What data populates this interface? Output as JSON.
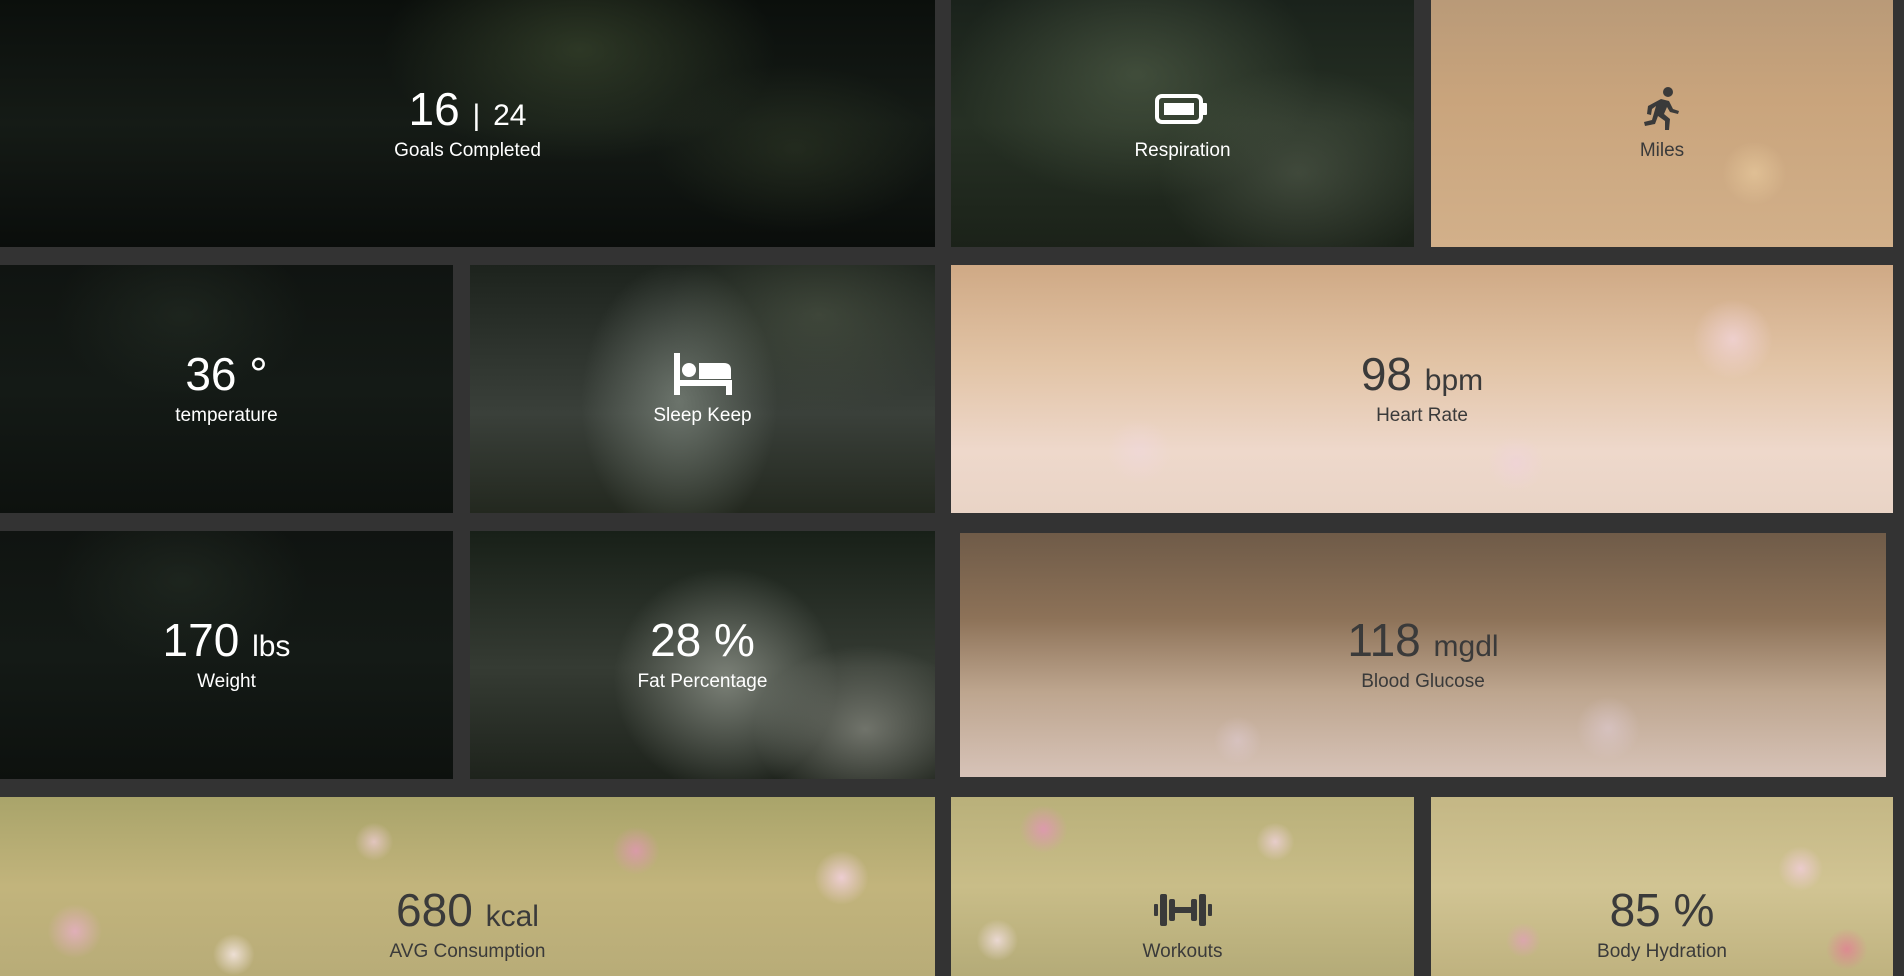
{
  "tiles": {
    "goals": {
      "value": "16",
      "separator": "|",
      "total": "24",
      "label": "Goals Completed"
    },
    "respiration": {
      "icon": "battery-icon",
      "label": "Respiration"
    },
    "miles": {
      "icon": "running-icon",
      "label": "Miles"
    },
    "temperature": {
      "value": "36",
      "unit": "°",
      "label": "temperature"
    },
    "sleep": {
      "icon": "bed-icon",
      "label": "Sleep Keep"
    },
    "heart_rate": {
      "value": "98",
      "unit": "bpm",
      "label": "Heart Rate"
    },
    "weight": {
      "value": "170",
      "unit": "lbs",
      "label": "Weight"
    },
    "fat": {
      "value": "28",
      "unit": "%",
      "label": "Fat Percentage"
    },
    "glucose": {
      "value": "118",
      "unit": "mgdl",
      "label": "Blood Glucose"
    },
    "consumption": {
      "value": "680",
      "unit": "kcal",
      "label": "AVG Consumption"
    },
    "workouts": {
      "icon": "dumbbell-icon",
      "label": "Workouts"
    },
    "hydration": {
      "value": "85",
      "unit": "%",
      "label": "Body Hydration"
    }
  },
  "colors": {
    "gutter": "#333333",
    "light_text": "#ffffff",
    "dark_text": "#3a3a3a"
  }
}
